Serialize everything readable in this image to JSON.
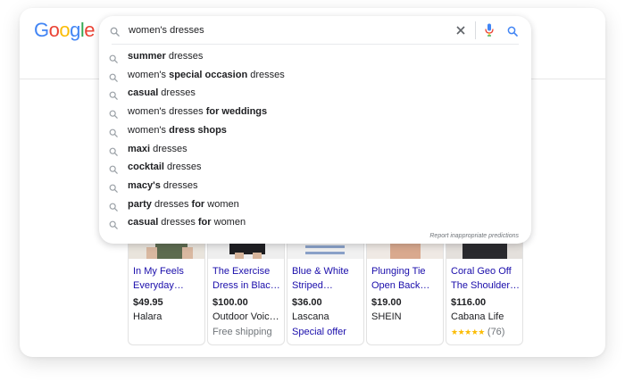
{
  "logo": {
    "letters": [
      "G",
      "o",
      "o",
      "g",
      "l",
      "e"
    ],
    "colors": [
      "#4285F4",
      "#EA4335",
      "#FBBC05",
      "#4285F4",
      "#34A853",
      "#EA4335"
    ]
  },
  "search": {
    "value": "women's dresses"
  },
  "suggestions": [
    {
      "parts": [
        {
          "t": "summer",
          "b": true
        },
        {
          "t": " dresses",
          "b": false
        }
      ]
    },
    {
      "parts": [
        {
          "t": "women's ",
          "b": false
        },
        {
          "t": "special occasion",
          "b": true
        },
        {
          "t": " dresses",
          "b": false
        }
      ]
    },
    {
      "parts": [
        {
          "t": "casual",
          "b": true
        },
        {
          "t": " dresses",
          "b": false
        }
      ]
    },
    {
      "parts": [
        {
          "t": "women's dresses ",
          "b": false
        },
        {
          "t": "for weddings",
          "b": true
        }
      ]
    },
    {
      "parts": [
        {
          "t": "women's ",
          "b": false
        },
        {
          "t": "dress shops",
          "b": true
        }
      ]
    },
    {
      "parts": [
        {
          "t": "maxi",
          "b": true
        },
        {
          "t": " dresses",
          "b": false
        }
      ]
    },
    {
      "parts": [
        {
          "t": "cocktail",
          "b": true
        },
        {
          "t": " dresses",
          "b": false
        }
      ]
    },
    {
      "parts": [
        {
          "t": "macy's",
          "b": true
        },
        {
          "t": " dresses",
          "b": false
        }
      ]
    },
    {
      "parts": [
        {
          "t": "party",
          "b": true
        },
        {
          "t": " dresses ",
          "b": false
        },
        {
          "t": "for",
          "b": true
        },
        {
          "t": " women",
          "b": false
        }
      ]
    },
    {
      "parts": [
        {
          "t": "casual",
          "b": true
        },
        {
          "t": " dresses ",
          "b": false
        },
        {
          "t": "for",
          "b": true
        },
        {
          "t": " women",
          "b": false
        }
      ]
    }
  ],
  "report_label": "Report inappropriate predictions",
  "products": [
    {
      "title_line1": "In My Feels",
      "title_line2": "Everyday…",
      "price": "$49.95",
      "store": "Halara",
      "extra": "",
      "extra_type": "none"
    },
    {
      "title_line1": "The Exercise",
      "title_line2": "Dress in Blac…",
      "price": "$100.00",
      "store": "Outdoor Voic…",
      "extra": "Free shipping",
      "extra_type": "gray"
    },
    {
      "title_line1": "Blue & White",
      "title_line2": "Striped…",
      "price": "$36.00",
      "store": "Lascana",
      "extra": "Special offer",
      "extra_type": "link"
    },
    {
      "title_line1": "Plunging Tie",
      "title_line2": "Open Back…",
      "price": "$19.00",
      "store": "SHEIN",
      "extra": "",
      "extra_type": "none"
    },
    {
      "title_line1": "Coral Geo Off",
      "title_line2": "The Shoulder…",
      "price": "$116.00",
      "store": "Cabana Life",
      "extra": "",
      "extra_type": "rating",
      "stars": "★★★★★",
      "rating_count": "(76)"
    }
  ],
  "icons": {
    "search": "search-icon",
    "clear": "close-icon",
    "voice": "microphone-icon",
    "submit": "search-icon"
  },
  "colors": {
    "link": "#1a0dab",
    "text": "#202124",
    "muted": "#70757a",
    "star": "#fbbc04",
    "mic_blue": "#4285F4",
    "mic_red": "#EA4335"
  }
}
